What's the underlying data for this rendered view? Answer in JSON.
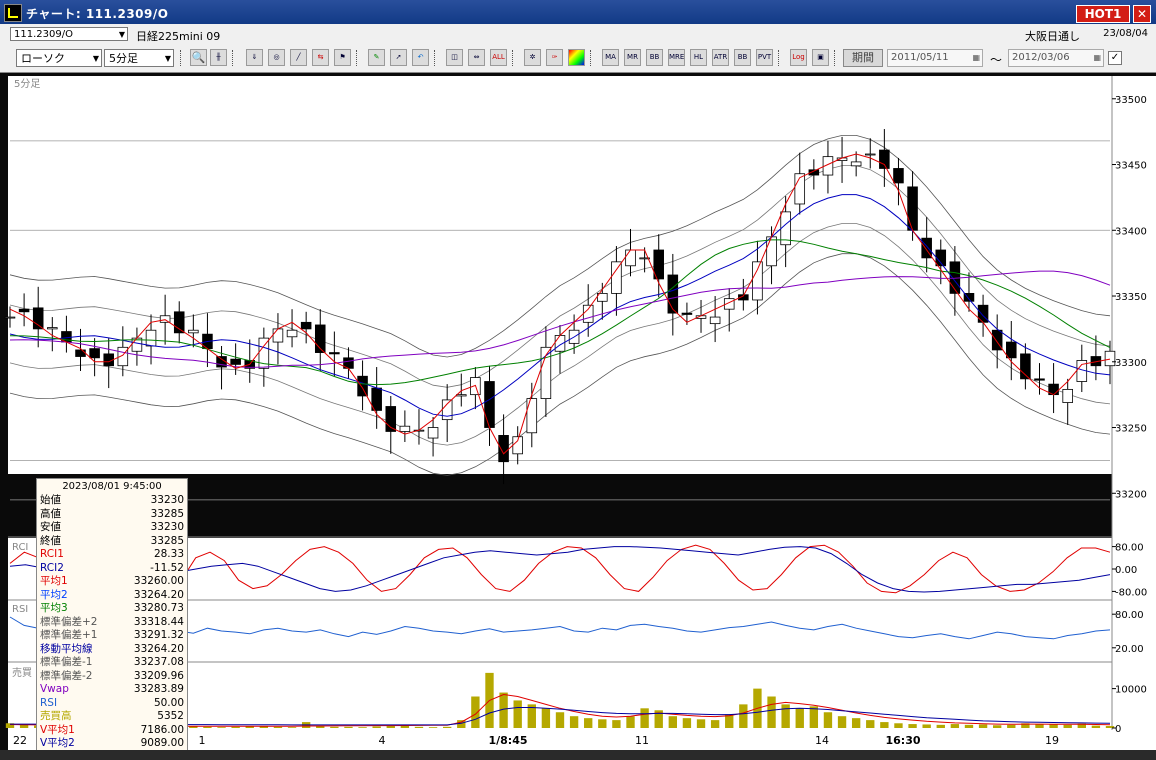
{
  "window": {
    "title": "チャート: 111.2309/O",
    "hot_badge": "HOT1",
    "close_icon": "close-icon"
  },
  "infobar": {
    "symbol": "111.2309/O",
    "instrument": "日経225mini 09",
    "session": "大阪日通し",
    "date": "23/08/04"
  },
  "toolbar": {
    "chart_type": "ローソク",
    "interval": "5分足",
    "tools": [
      "zoom-icon",
      "cursor-icon",
      "download-icon",
      "find-icon",
      "trendline-icon",
      "compare-icon",
      "flag-icon",
      "pencil-icon",
      "arrow-icon",
      "undo-icon",
      "fit-icon",
      "scroll-icon",
      "all-icon",
      "settings-icon",
      "wrench-icon",
      "color-icon",
      "ma-icon",
      "mr-icon",
      "bb-icon",
      "mre-icon",
      "hl-icon",
      "atr-icon",
      "bb2-icon",
      "pvt-icon",
      "log-icon",
      "split-icon"
    ],
    "tool_labels": {
      "all": "ALL",
      "ma": "MA",
      "mr": "MR",
      "bb": "BB",
      "mre": "MRE",
      "hl": "HL",
      "atr": "ATR",
      "pvt": "PVT",
      "log": "Log"
    },
    "period_label": "期間",
    "date_from": "2011/05/11",
    "date_to": "2012/03/06",
    "tilde": "〜"
  },
  "panels": {
    "price_label": "5分足",
    "rci_label": "RCI",
    "rsi_label": "RSI",
    "vol_label": "売買"
  },
  "chart_data": [
    {
      "type": "candlestick",
      "panel": "price",
      "title": "5分足",
      "y_ticks": [
        33500,
        33450,
        33400,
        33350,
        33300,
        33250,
        33200
      ],
      "ylim": [
        33185,
        33512
      ],
      "x_ticks": [
        "22",
        "1",
        "4",
        "1/8:45",
        "11",
        "14",
        "16:30",
        "19"
      ],
      "levels": [
        33468,
        33400,
        33225,
        33195
      ],
      "series": [
        {
          "name": "平均1",
          "color": "#e00000",
          "values": [
            33340,
            33335,
            33328,
            33320,
            33315,
            33310,
            33300,
            33300,
            33305,
            33318,
            33330,
            33332,
            33325,
            33318,
            33310,
            33302,
            33295,
            33298,
            33312,
            33325,
            33330,
            33322,
            33310,
            33300,
            33295,
            33280,
            33260,
            33250,
            33245,
            33248,
            33256,
            33268,
            33278,
            33282,
            33250,
            33230,
            33240,
            33275,
            33305,
            33320,
            33330,
            33340,
            33355,
            33370,
            33385,
            33385,
            33360,
            33340,
            33330,
            33335,
            33340,
            33345,
            33350,
            33370,
            33395,
            33420,
            33440,
            33445,
            33450,
            33455,
            33458,
            33455,
            33450,
            33430,
            33400,
            33385,
            33370,
            33355,
            33340,
            33330,
            33315,
            33300,
            33290,
            33280,
            33275,
            33285,
            33298,
            33300,
            33302
          ]
        }
      ]
    },
    {
      "type": "line",
      "panel": "rci",
      "y_ticks": [
        80.0,
        0.0,
        -80.0
      ],
      "ylim": [
        -100,
        100
      ],
      "series": [
        {
          "name": "RCI1",
          "color": "#e00000",
          "values": [
            20,
            60,
            40,
            -30,
            -60,
            -20,
            40,
            70,
            60,
            20,
            -60,
            -80,
            -40,
            40,
            60,
            30,
            -40,
            -70,
            -60,
            -20,
            30,
            70,
            80,
            60,
            20,
            -40,
            -80,
            -70,
            -20,
            40,
            70,
            75,
            40,
            -20,
            -70,
            -80,
            -40,
            20,
            60,
            80,
            75,
            40,
            -20,
            -70,
            -80,
            -30,
            30,
            70,
            85,
            70,
            20,
            -40,
            -75,
            -70,
            -20,
            40,
            80,
            85,
            60,
            10,
            -50,
            -80,
            -85,
            -60,
            -20,
            30,
            60,
            40,
            -20,
            -60,
            -80,
            -75,
            -50,
            -10,
            40,
            75,
            75,
            60
          ]
        },
        {
          "name": "RCI2",
          "color": "#0000a0",
          "values": [
            10,
            15,
            5,
            -20,
            -40,
            -55,
            -60,
            -55,
            -45,
            -30,
            -20,
            -10,
            0,
            10,
            15,
            20,
            10,
            -10,
            -30,
            -50,
            -70,
            -80,
            -75,
            -60,
            -40,
            -20,
            0,
            20,
            40,
            50,
            60,
            65,
            60,
            55,
            50,
            55,
            60,
            70,
            75,
            80,
            80,
            78,
            75,
            70,
            65,
            60,
            55,
            50,
            60,
            70,
            78,
            80,
            75,
            55,
            20,
            -20,
            -50,
            -70,
            -80,
            -82,
            -80,
            -75,
            -70,
            -65,
            -60,
            -55,
            -55,
            -50,
            -45,
            -40,
            -30,
            -20
          ]
        }
      ]
    },
    {
      "type": "line",
      "panel": "rsi",
      "y_ticks": [
        80.0,
        20.0
      ],
      "ylim": [
        0,
        100
      ],
      "series": [
        {
          "name": "RSI",
          "color": "#2060d0",
          "values": [
            75,
            60,
            55,
            50,
            45,
            52,
            48,
            55,
            50,
            45,
            48,
            52,
            50,
            46,
            55,
            50,
            48,
            45,
            52,
            55,
            50,
            48,
            52,
            45,
            40,
            48,
            44,
            50,
            58,
            55,
            50,
            48,
            45,
            50,
            54,
            48,
            50,
            52,
            55,
            58,
            50,
            48,
            55,
            52,
            60,
            62,
            58,
            55,
            50,
            48,
            52,
            56,
            58,
            62,
            66,
            60,
            55,
            52,
            58,
            62,
            55,
            50,
            45,
            40,
            38,
            42,
            45,
            40,
            36,
            42,
            48,
            45,
            40,
            38,
            36,
            42,
            45,
            50,
            52
          ]
        }
      ]
    },
    {
      "type": "bar",
      "panel": "volume",
      "y_ticks": [
        10000,
        0
      ],
      "ylim": [
        0,
        16000
      ],
      "series": [
        {
          "name": "売買高",
          "color": "#b5a800",
          "values": [
            1200,
            800,
            600,
            500,
            700,
            400,
            300,
            500,
            600,
            400,
            300,
            500,
            800,
            400,
            300,
            200,
            300,
            400,
            500,
            300,
            200,
            1500,
            400,
            300,
            300,
            200,
            400,
            500,
            600,
            300,
            200,
            300,
            2000,
            8000,
            14000,
            9000,
            7000,
            6000,
            5000,
            4000,
            3000,
            2500,
            2200,
            2000,
            3000,
            5000,
            4500,
            3000,
            2500,
            2200,
            2000,
            3500,
            6000,
            10000,
            8000,
            6000,
            5000,
            5500,
            4000,
            3000,
            2500,
            2000,
            1500,
            1200,
            1000,
            900,
            800,
            1000,
            800,
            900,
            700,
            800,
            1200,
            1000,
            900,
            800,
            1100,
            600,
            500
          ]
        },
        {
          "name": "V平均1",
          "color": "#e00000",
          "values": [
            900,
            850,
            800,
            750,
            700,
            650,
            600,
            550,
            520,
            500,
            480,
            470,
            460,
            450,
            440,
            430,
            420,
            420,
            430,
            440,
            450,
            500,
            520,
            540,
            560,
            580,
            600,
            620,
            640,
            660,
            680,
            700,
            1500,
            3500,
            7000,
            8500,
            8000,
            7000,
            6000,
            5000,
            4200,
            3500,
            3000,
            2800,
            3000,
            3500,
            3800,
            3500,
            3200,
            3000,
            2900,
            3100,
            3800,
            5000,
            6000,
            6500,
            6200,
            5800,
            5200,
            4500,
            3800,
            3200,
            2700,
            2300,
            2000,
            1700,
            1500,
            1300,
            1200,
            1100,
            1000,
            950,
            980,
            990,
            960,
            940,
            950,
            900,
            850
          ]
        },
        {
          "name": "V平均2",
          "color": "#0000a0",
          "values": [
            1000,
            990,
            980,
            970,
            960,
            950,
            940,
            930,
            920,
            910,
            900,
            890,
            880,
            870,
            860,
            850,
            840,
            830,
            820,
            810,
            800,
            800,
            800,
            800,
            800,
            800,
            800,
            800,
            800,
            800,
            800,
            800,
            1200,
            2200,
            3800,
            4800,
            5200,
            5200,
            5000,
            4800,
            4500,
            4200,
            3900,
            3700,
            3600,
            3600,
            3700,
            3700,
            3600,
            3500,
            3400,
            3400,
            3600,
            4000,
            4500,
            4900,
            5000,
            4900,
            4700,
            4400,
            4100,
            3800,
            3500,
            3200,
            2900,
            2600,
            2400,
            2200,
            2000,
            1800,
            1700,
            1600,
            1500,
            1450,
            1400,
            1350,
            1300,
            1250,
            1200
          ]
        }
      ]
    }
  ],
  "databox": {
    "datetime": "2023/08/01 9:45:00",
    "rows": [
      {
        "k": "始値",
        "v": "33230",
        "color": "#000000"
      },
      {
        "k": "高値",
        "v": "33285",
        "color": "#000000"
      },
      {
        "k": "安値",
        "v": "33230",
        "color": "#000000"
      },
      {
        "k": "終値",
        "v": "33285",
        "color": "#000000"
      },
      {
        "k": "RCI1",
        "v": "28.33",
        "color": "#e00000"
      },
      {
        "k": "RCI2",
        "v": "-11.52",
        "color": "#0000a0"
      },
      {
        "k": "平均1",
        "v": "33260.00",
        "color": "#e00000"
      },
      {
        "k": "平均2",
        "v": "33264.20",
        "color": "#0040ff"
      },
      {
        "k": "平均3",
        "v": "33280.73",
        "color": "#008000"
      },
      {
        "k": "標準偏差+2",
        "v": "33318.44",
        "color": "#555555"
      },
      {
        "k": "標準偏差+1",
        "v": "33291.32",
        "color": "#555555"
      },
      {
        "k": "移動平均線",
        "v": "33264.20",
        "color": "#0000a0"
      },
      {
        "k": "標準偏差-1",
        "v": "33237.08",
        "color": "#555555"
      },
      {
        "k": "標準偏差-2",
        "v": "33209.96",
        "color": "#555555"
      },
      {
        "k": "Vwap",
        "v": "33283.89",
        "color": "#8000c0"
      },
      {
        "k": "RSI",
        "v": "50.00",
        "color": "#2060d0"
      },
      {
        "k": "売買高",
        "v": "5352",
        "color": "#b5a800"
      },
      {
        "k": "V平均1",
        "v": "7186.00",
        "color": "#e00000"
      },
      {
        "k": "V平均2",
        "v": "9089.00",
        "color": "#0000a0"
      }
    ]
  },
  "colors": {
    "bg": "#ffffff",
    "frame": "#0a0a0a",
    "accent": "#d31e15"
  }
}
